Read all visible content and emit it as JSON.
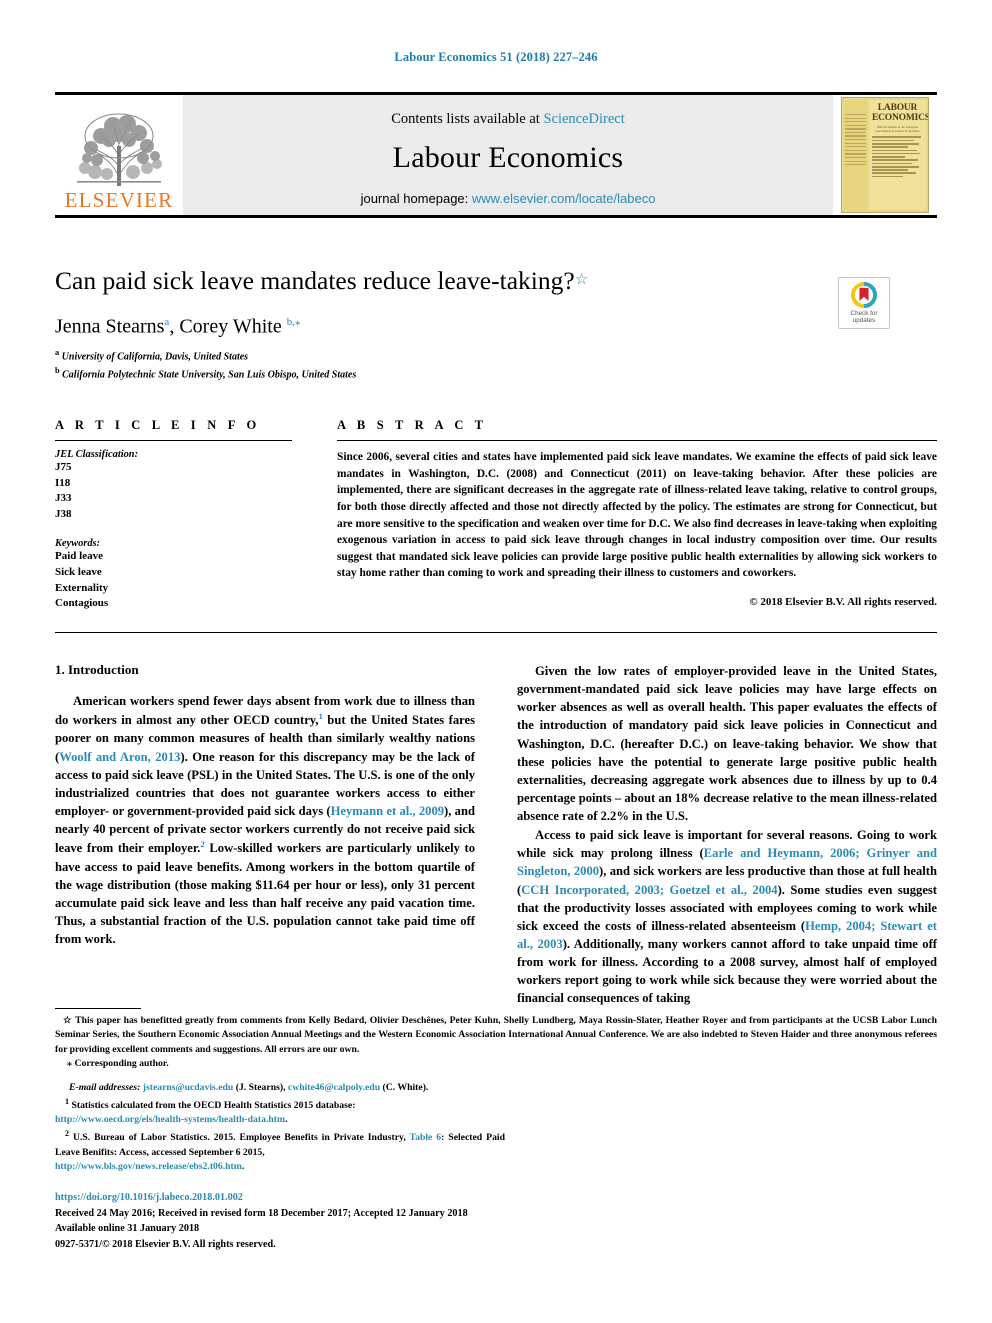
{
  "running_head": "Labour Economics 51 (2018) 227–246",
  "banner": {
    "publisher_name": "ELSEVIER",
    "contents_prefix": "Contents lists available at ",
    "contents_link": "ScienceDirect",
    "journal_name": "Labour Economics",
    "homepage_prefix": "journal homepage: ",
    "homepage_url": "www.elsevier.com/locate/labeco",
    "cover_title_line1": "LABOUR",
    "cover_title_line2": "ECONOMICS",
    "cover_subtitle": "Official Journal of the European Association of Labour Economists",
    "cover_issn": "ISSN 0927-5371"
  },
  "article": {
    "title": "Can paid sick leave mandates reduce leave-taking?",
    "title_footnote_mark": "☆",
    "authors": [
      {
        "name": "Jenna Stearns",
        "marks": "a"
      },
      {
        "name": "Corey White",
        "marks": "b,⁎"
      }
    ],
    "authors_display": "Jenna Stearns",
    "author2_display": "Corey White",
    "affiliations": [
      {
        "mark": "a",
        "text": "University of California, Davis, United States"
      },
      {
        "mark": "b",
        "text": "California Polytechnic State University, San Luis Obispo, United States"
      }
    ],
    "crossmark_line1": "Check for",
    "crossmark_line2": "updates"
  },
  "info": {
    "heading": "A R T I C L E  I N F O",
    "jel_heading": "JEL Classification:",
    "jel_codes": [
      "J75",
      "I18",
      "J33",
      "J38"
    ],
    "keywords_heading": "Keywords:",
    "keywords": [
      "Paid leave",
      "Sick leave",
      "Externality",
      "Contagious"
    ]
  },
  "abstract": {
    "heading": "A B S T R A C T",
    "text": "Since 2006, several cities and states have implemented paid sick leave mandates. We examine the effects of paid sick leave mandates in Washington, D.C. (2008) and Connecticut (2011) on leave-taking behavior. After these policies are implemented, there are significant decreases in the aggregate rate of illness-related leave taking, relative to control groups, for both those directly affected and those not directly affected by the policy. The estimates are strong for Connecticut, but are more sensitive to the specification and weaken over time for D.C. We also find decreases in leave-taking when exploiting exogenous variation in access to paid sick leave through changes in local industry composition over time. Our results suggest that mandated sick leave policies can provide large positive public health externalities by allowing sick workers to stay home rather than coming to work and spreading their illness to customers and coworkers.",
    "copyright": "© 2018 Elsevier B.V. All rights reserved."
  },
  "body": {
    "section_heading": "1. Introduction",
    "left_para_1_a": "American workers spend fewer days absent from work due to illness than do workers in almost any other OECD country,",
    "left_para_1_fn": "1",
    "left_para_1_b": " but the United States fares poorer on many common measures of health than similarly wealthy nations (",
    "left_cite_1": "Woolf and Aron, 2013",
    "left_para_1_c": "). One reason for this discrepancy may be the lack of access to paid sick leave (PSL) in the United States. The U.S. is one of the only industrialized countries that does not guarantee workers access to either employer- or government-provided paid sick days (",
    "left_cite_2": "Heymann et al., 2009",
    "left_para_1_d": "), and nearly 40 percent of private sector workers currently do not receive paid sick leave from their employer.",
    "left_para_1_fn2": "2",
    "left_para_1_e": " Low-skilled workers are particularly unlikely to have access to paid leave benefits. Among workers in the bottom quartile of the wage distribution (those making $11.64 per hour or less), only 31 percent accumulate paid sick leave and less than half receive any paid vacation time. Thus, a substantial fraction of the U.S. population cannot take paid time off from work.",
    "right_para_1": "Given the low rates of employer-provided leave in the United States, government-mandated paid sick leave policies may have large effects on worker absences as well as overall health. This paper evaluates the effects of the introduction of mandatory paid sick leave policies in Connecticut and Washington, D.C. (hereafter D.C.) on leave-taking behavior. We show that these policies have the potential to generate large positive public health externalities, decreasing aggregate work absences due to illness by up to 0.4 percentage points – about an 18% decrease relative to the mean illness-related absence rate of 2.2% in the U.S.",
    "right_para_2_a": "Access to paid sick leave is important for several reasons. Going to work while sick may prolong illness (",
    "right_cite_1": "Earle and Heymann, 2006; Grinyer and Singleton, 2000",
    "right_para_2_b": "), and sick workers are less productive than those at full health (",
    "right_cite_2": "CCH Incorporated, 2003; Goetzel et al., 2004",
    "right_para_2_c": "). Some studies even suggest that the productivity losses associated with employees coming to work while sick exceed the costs of illness-related absenteeism (",
    "right_cite_3": "Hemp, 2004; Stewart et al., 2003",
    "right_para_2_d": "). Additionally, many workers cannot afford to take unpaid time off from work for illness. According to a 2008 survey, almost half of employed workers report going to work while sick because they were worried about the financial consequences of taking"
  },
  "footnotes": {
    "acknowledgement_mark": "☆",
    "acknowledgement": "This paper has benefitted greatly from comments from Kelly Bedard, Olivier Deschênes, Peter Kuhn, Shelly Lundberg, Maya Rossin-Slater, Heather Royer and from participants at the UCSB Labor Lunch Seminar Series, the Southern Economic Association Annual Meetings and the Western Economic Association International Annual Conference. We are also indebted to Steven Haider and three anonymous referees for providing excellent comments and suggestions. All errors are our own.",
    "corresponding_mark": "⁎",
    "corresponding": "Corresponding author.",
    "email_label": "E-mail addresses:",
    "email_1": "jstearns@ucdavis.edu",
    "email_1_owner": "(J. Stearns),",
    "email_2": "cwhite46@calpoly.edu",
    "email_2_owner": "(C. White).",
    "fn1_mark": "1",
    "fn1_text": "Statistics calculated from the OECD Health Statistics 2015 database:",
    "fn1_url": "http://www.oecd.org/els/health-systems/health-data.htm",
    "fn2_mark": "2",
    "fn2_text_a": "U.S. Bureau of Labor Statistics. 2015. Employee Benefits in Private Industry,",
    "fn2_table_link": "Table 6",
    "fn2_text_b": ": Selected Paid Leave Benifits: Access, accessed September 6 2015,",
    "fn2_url": "http://www.bls.gov/news.release/ebs2.t06.htm"
  },
  "footer": {
    "doi": "https://doi.org/10.1016/j.labeco.2018.01.002",
    "history": "Received 24 May 2016; Received in revised form 18 December 2017; Accepted 12 January 2018",
    "available": "Available online 31 January 2018",
    "issn_line": "0927-5371/© 2018 Elsevier B.V. All rights reserved."
  },
  "colors": {
    "link": "#2a8bb5",
    "running_head": "#1a7fa8",
    "elsevier_orange": "#E87722",
    "banner_bg": "#ebebeb"
  }
}
